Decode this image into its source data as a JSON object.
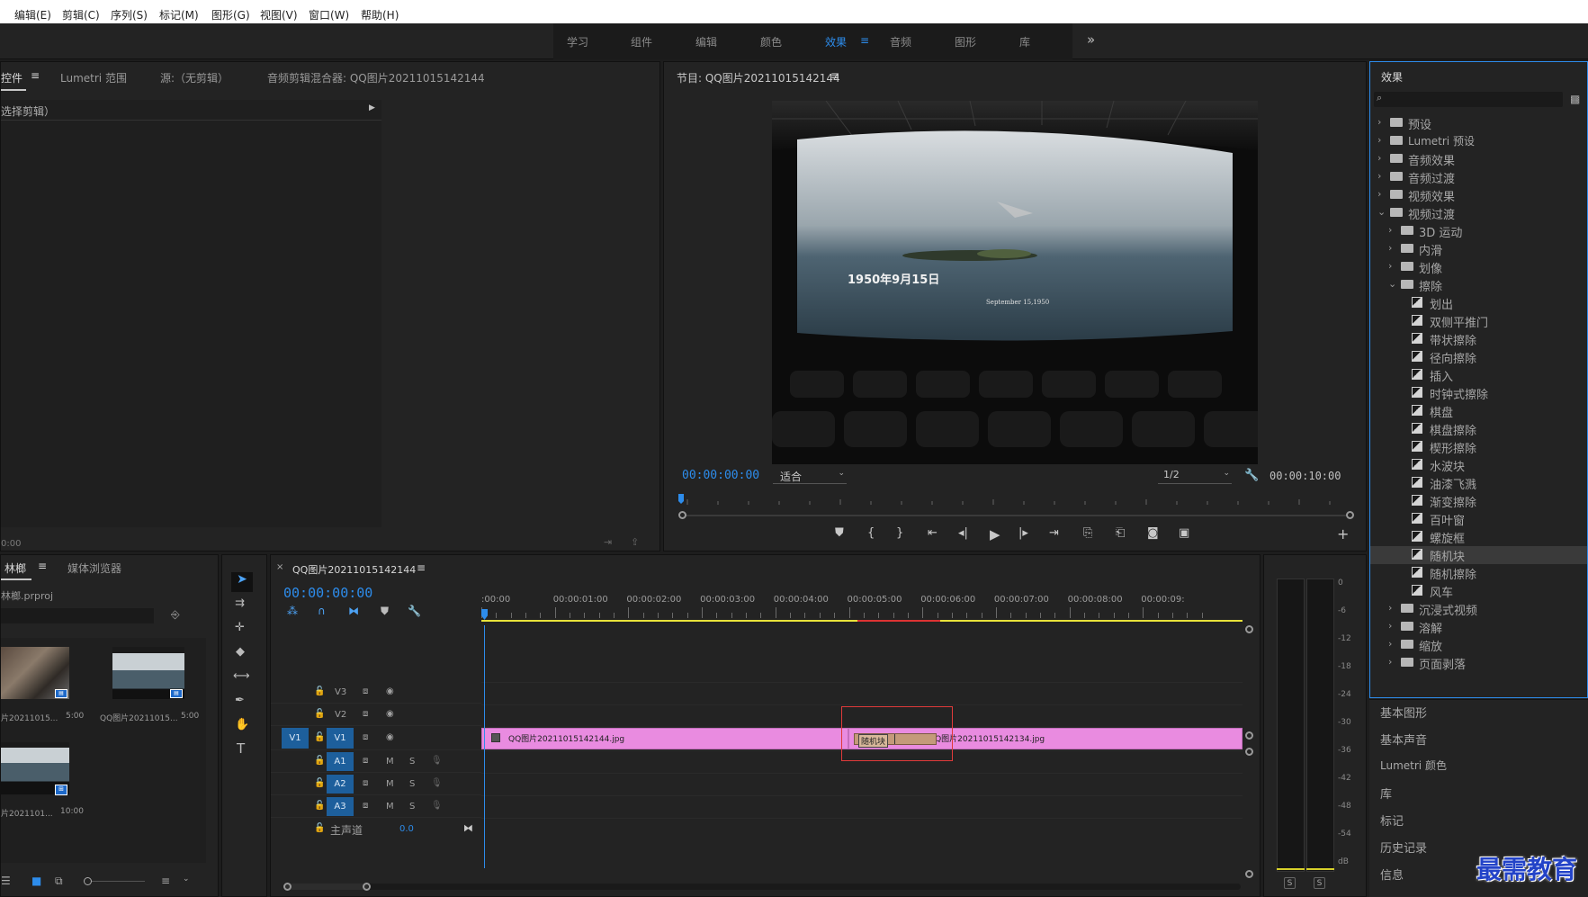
{
  "menubar": {
    "items": [
      "编辑(E)",
      "剪辑(C)",
      "序列(S)",
      "标记(M)",
      "图形(G)",
      "视图(V)",
      "窗口(W)",
      "帮助(H)"
    ]
  },
  "workspaces": {
    "items": [
      "学习",
      "组件",
      "编辑",
      "颜色",
      "效果",
      "音频",
      "图形",
      "库"
    ],
    "active": "效果",
    "more_icon": "double-chevron-right-icon"
  },
  "source_panel": {
    "tabs": [
      "控件",
      "Lumetri 范围",
      "源:（无剪辑）",
      "音频剪辑混合器: QQ图片20211015142144"
    ],
    "active_tab": "控件",
    "selection_label": "选择剪辑）",
    "timecode": "0:00"
  },
  "program_monitor": {
    "title": "节目: QQ图片20211015142144",
    "timecode_current": "00:00:00:00",
    "fit_label": "适合",
    "resolution": "1/2",
    "timecode_duration": "00:00:10:00",
    "frame_text_main": "1950年9月15日",
    "frame_text_sub": "September 15,1950"
  },
  "project_panel": {
    "tabs": [
      "林榔",
      "媒体浏览器"
    ],
    "project_file": "林榔.prproj",
    "items": [
      {
        "name": "片20211015...",
        "duration": "5:00"
      },
      {
        "name": "QQ图片20211015...",
        "duration": "5:00"
      },
      {
        "name": "片2021101...",
        "duration": "10:00"
      }
    ]
  },
  "timeline": {
    "sequence_name": "QQ图片20211015142144",
    "timecode": "00:00:00:00",
    "ruler_labels": [
      ":00:00",
      "00:00:01:00",
      "00:00:02:00",
      "00:00:03:00",
      "00:00:04:00",
      "00:00:05:00",
      "00:00:06:00",
      "00:00:07:00",
      "00:00:08:00",
      "00:00:09:"
    ],
    "video_tracks": [
      "V3",
      "V2",
      "V1"
    ],
    "audio_tracks": [
      "A1",
      "A2",
      "A3"
    ],
    "source_patch_v": "V1",
    "master_label": "主声道",
    "master_value": "0.0",
    "mute_label": "M",
    "solo_label": "S",
    "clips": [
      {
        "name": "QQ图片20211015142144.jpg"
      },
      {
        "name": "QQ图片20211015142134.jpg"
      }
    ],
    "transition_label": "随机块"
  },
  "effects_panel": {
    "title": "效果",
    "search_placeholder": "",
    "tree": [
      {
        "label": "预设",
        "level": 0,
        "kind": "folder",
        "expanded": false
      },
      {
        "label": "Lumetri 预设",
        "level": 0,
        "kind": "folder",
        "expanded": false
      },
      {
        "label": "音频效果",
        "level": 0,
        "kind": "folder",
        "expanded": false
      },
      {
        "label": "音频过渡",
        "level": 0,
        "kind": "folder",
        "expanded": false
      },
      {
        "label": "视频效果",
        "level": 0,
        "kind": "folder",
        "expanded": false
      },
      {
        "label": "视频过渡",
        "level": 0,
        "kind": "folder",
        "expanded": true
      },
      {
        "label": "3D 运动",
        "level": 1,
        "kind": "folder",
        "expanded": false
      },
      {
        "label": "内滑",
        "level": 1,
        "kind": "folder",
        "expanded": false
      },
      {
        "label": "划像",
        "level": 1,
        "kind": "folder",
        "expanded": false
      },
      {
        "label": "擦除",
        "level": 1,
        "kind": "folder",
        "expanded": true
      },
      {
        "label": "划出",
        "level": 2,
        "kind": "effect"
      },
      {
        "label": "双侧平推门",
        "level": 2,
        "kind": "effect"
      },
      {
        "label": "带状擦除",
        "level": 2,
        "kind": "effect"
      },
      {
        "label": "径向擦除",
        "level": 2,
        "kind": "effect"
      },
      {
        "label": "插入",
        "level": 2,
        "kind": "effect"
      },
      {
        "label": "时钟式擦除",
        "level": 2,
        "kind": "effect"
      },
      {
        "label": "棋盘",
        "level": 2,
        "kind": "effect"
      },
      {
        "label": "棋盘擦除",
        "level": 2,
        "kind": "effect"
      },
      {
        "label": "楔形擦除",
        "level": 2,
        "kind": "effect"
      },
      {
        "label": "水波块",
        "level": 2,
        "kind": "effect"
      },
      {
        "label": "油漆飞溅",
        "level": 2,
        "kind": "effect"
      },
      {
        "label": "渐变擦除",
        "level": 2,
        "kind": "effect"
      },
      {
        "label": "百叶窗",
        "level": 2,
        "kind": "effect"
      },
      {
        "label": "螺旋框",
        "level": 2,
        "kind": "effect"
      },
      {
        "label": "随机块",
        "level": 2,
        "kind": "effect",
        "selected": true
      },
      {
        "label": "随机擦除",
        "level": 2,
        "kind": "effect"
      },
      {
        "label": "风车",
        "level": 2,
        "kind": "effect"
      },
      {
        "label": "沉浸式视频",
        "level": 1,
        "kind": "folder",
        "expanded": false
      },
      {
        "label": "溶解",
        "level": 1,
        "kind": "folder",
        "expanded": false
      },
      {
        "label": "缩放",
        "level": 1,
        "kind": "folder",
        "expanded": false
      },
      {
        "label": "页面剥落",
        "level": 1,
        "kind": "folder",
        "expanded": false
      }
    ]
  },
  "right_panels": [
    "基本图形",
    "基本声音",
    "Lumetri 颜色",
    "库",
    "标记",
    "历史记录",
    "信息"
  ],
  "audio_meter": {
    "scale": [
      "0",
      "-6",
      "-12",
      "-18",
      "-24",
      "-30",
      "-36",
      "-42",
      "-48",
      "-54",
      "dB"
    ],
    "solo_labels": [
      "S",
      "S"
    ]
  },
  "watermark": "最需教育",
  "colors": {
    "accent": "#2d8ceb",
    "clip": "#e98be0",
    "transition": "#c49a7a",
    "highlight": "#e03a3a",
    "work_area": "#e8e23a"
  }
}
